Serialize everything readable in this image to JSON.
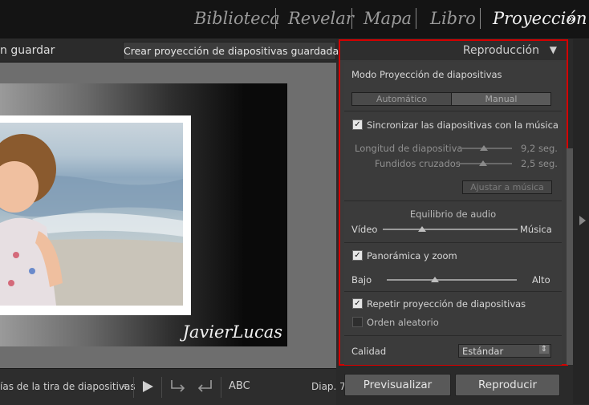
{
  "modules": [
    "Biblioteca",
    "Revelar",
    "Mapa",
    "Libro",
    "Proyección"
  ],
  "modules_more": "»",
  "toolbar": {
    "title": "n guardar",
    "save_button": "Crear proyección de diapositivas guardada"
  },
  "slide": {
    "identity_plate": "JavierLucas"
  },
  "bottom": {
    "filmstrip_select": "ías de la tira de diapositivas",
    "select_arrow": "÷",
    "abc": "ABC",
    "slide_counter": "Diap. 7"
  },
  "panel": {
    "title": "Reproducción",
    "collapse_icon": "▼",
    "mode_label": "Modo Proyección de diapositivas",
    "mode_options": [
      "Automático",
      "Manual"
    ],
    "sync_music": "Sincronizar las diapositivas con la música",
    "slide_length_label": "Longitud de diapositiva",
    "slide_length_value": "9,2 seg.",
    "crossfade_label": "Fundidos cruzados",
    "crossfade_value": "2,5 seg.",
    "fit_music_button": "Ajustar a música",
    "audio_balance_title": "Equilibrio de audio",
    "audio_left": "Vídeo",
    "audio_right": "Música",
    "pan_zoom": "Panorámica y zoom",
    "pan_low": "Bajo",
    "pan_high": "Alto",
    "repeat": "Repetir proyección de diapositivas",
    "random": "Orden aleatorio",
    "quality_label": "Calidad",
    "quality_value": "Estándar",
    "checkmark": "✓",
    "stepper": "⇕"
  },
  "buttons": {
    "preview": "Previsualizar",
    "play": "Reproducir"
  },
  "colors": {
    "highlight_border": "#d40000",
    "background": "#2a2a2a"
  }
}
